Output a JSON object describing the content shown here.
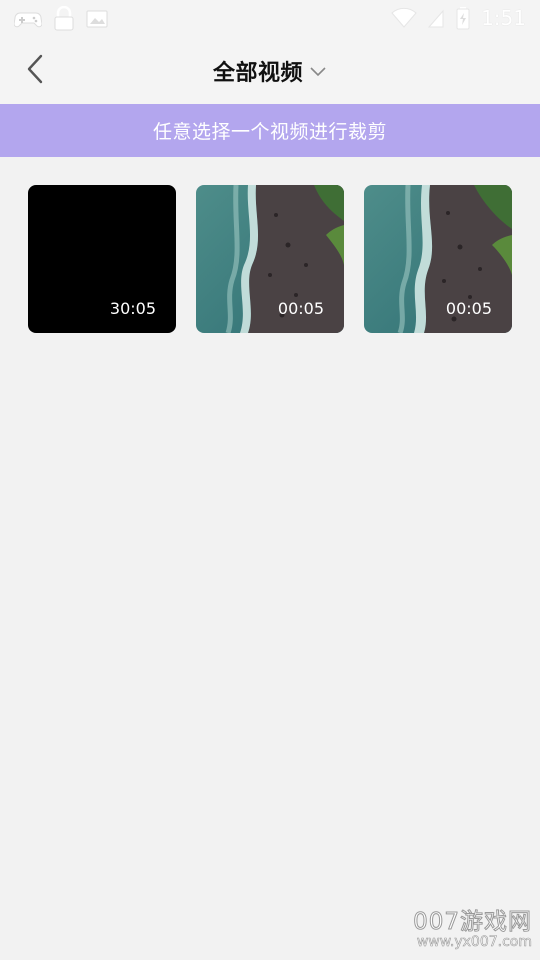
{
  "status_bar": {
    "time": "1:51",
    "left_icons": [
      "gamepad-icon",
      "lock-icon",
      "image-icon"
    ],
    "right_icons": [
      "wifi-icon",
      "signal-icon",
      "battery-icon"
    ]
  },
  "header": {
    "title": "全部视频",
    "back_icon": "chevron-left-icon",
    "dropdown_icon": "chevron-down-icon"
  },
  "banner": {
    "text": "任意选择一个视频进行裁剪",
    "color": "#b3a6ee"
  },
  "videos": [
    {
      "duration": "30:05",
      "style": "black"
    },
    {
      "duration": "00:05",
      "style": "coast"
    },
    {
      "duration": "00:05",
      "style": "coast"
    }
  ],
  "watermark": {
    "line1": "007游戏网",
    "line2": "www.yx007.com"
  }
}
